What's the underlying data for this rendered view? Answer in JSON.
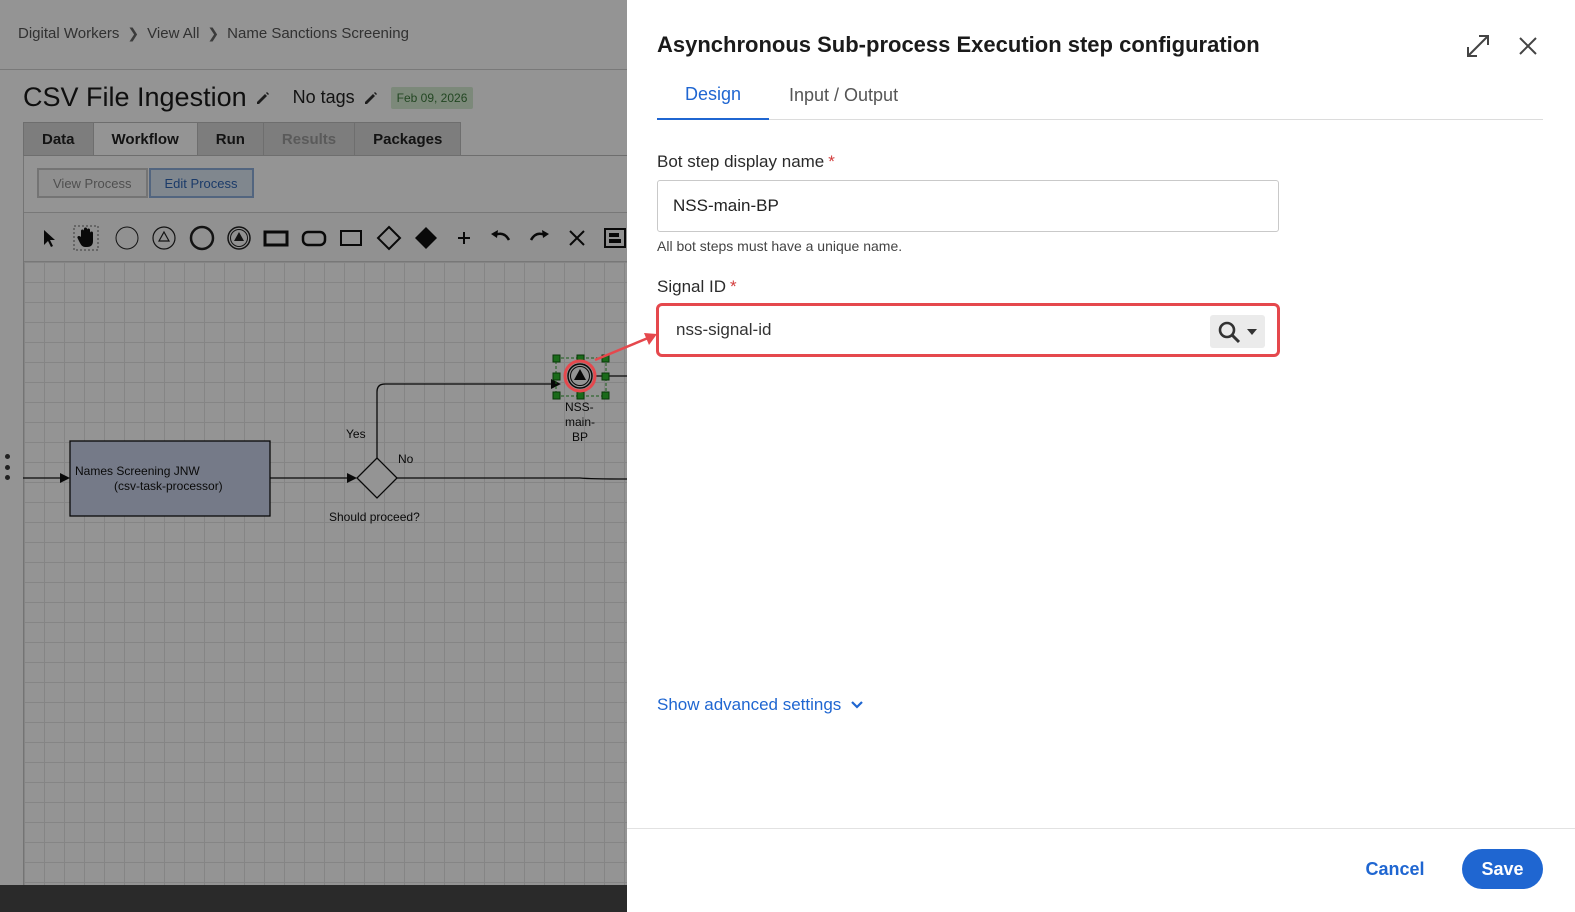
{
  "breadcrumb": [
    "Digital Workers",
    "View All",
    "Name Sanctions Screening"
  ],
  "process": {
    "title": "CSV File Ingestion",
    "tags": "No tags",
    "date": "Feb 09, 2026"
  },
  "tabs": [
    {
      "label": "Data"
    },
    {
      "label": "Workflow"
    },
    {
      "label": "Run"
    },
    {
      "label": "Results"
    },
    {
      "label": "Packages"
    }
  ],
  "modes": {
    "view": "View Process",
    "edit": "Edit Process"
  },
  "diagram": {
    "task_line1": "Names Screening JNW",
    "task_line2": "(csv-task-processor)",
    "gateway": "Should proceed?",
    "yes": "Yes",
    "no": "No",
    "event_label_1": "NSS-",
    "event_label_2": "main-",
    "event_label_3": "BP"
  },
  "panel": {
    "title": "Asynchronous Sub-process Execution step configuration",
    "tabs": {
      "design": "Design",
      "io": "Input / Output"
    },
    "display_name_label": "Bot step display name",
    "display_name_value": "NSS-main-BP",
    "display_name_hint": "All bot steps must have a unique name.",
    "signal_label": "Signal ID",
    "signal_value": "nss-signal-id",
    "required_mark": "*",
    "advanced": "Show advanced settings",
    "cancel": "Cancel",
    "save": "Save"
  },
  "colors": {
    "accent": "#1f66d1",
    "highlight": "#e5484d",
    "badge_bg": "#d6ecd2",
    "task_fill": "#cad3ea"
  }
}
